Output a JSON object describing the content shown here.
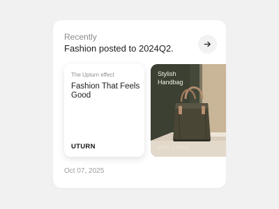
{
  "header": {
    "eyebrow": "Recently",
    "headline": "Fashion posted to 2024Q2.",
    "next_icon": "arrow-right-icon"
  },
  "text_card": {
    "eyebrow": "The Upturn effect",
    "title": "Fashion That Feels Good",
    "brand": "UTURN"
  },
  "image_card": {
    "label": "Stylish Handbag",
    "dimensions": "30CM X 40CM",
    "image": "handbag-product-photo"
  },
  "footer": {
    "date": "Oct 07, 2025"
  },
  "colors": {
    "page_background": "#f1f1f1",
    "card_background": "#ffffff",
    "photo_wall": "#3a3f31",
    "photo_wall_light": "#cdb99c",
    "pedestal": "#e6ddd0",
    "handbag": "#4a4636"
  }
}
